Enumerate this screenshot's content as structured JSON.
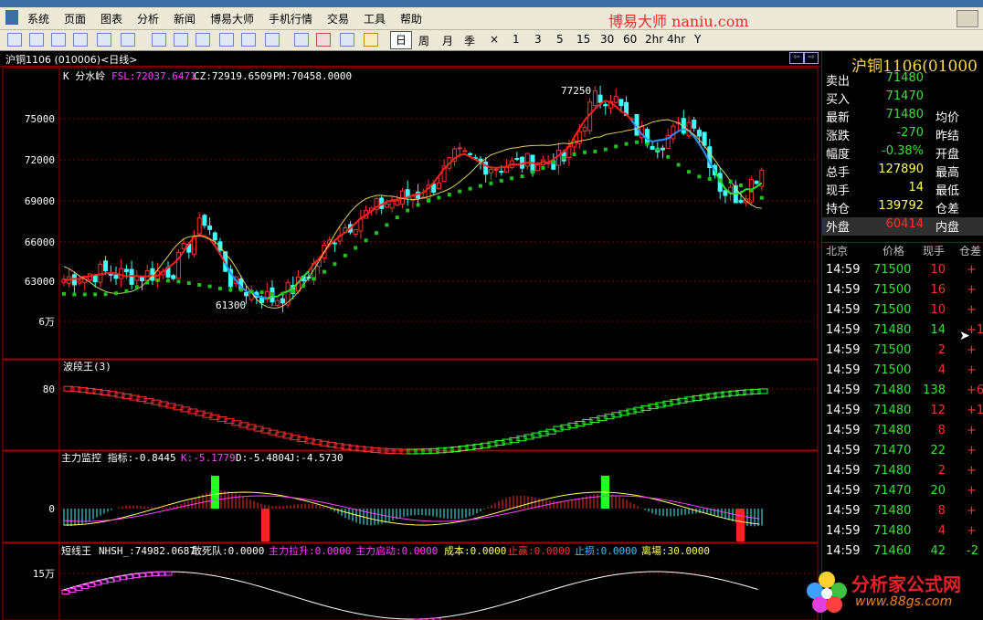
{
  "menu": [
    "系统",
    "页面",
    "图表",
    "分析",
    "新闻",
    "博易大师",
    "手机行情",
    "交易",
    "工具",
    "帮助"
  ],
  "brand": "博易大师 naniu.com",
  "periods": [
    "日",
    "周",
    "月",
    "季",
    "×",
    "1",
    "3",
    "5",
    "15",
    "30",
    "60",
    "2hr",
    "4hr",
    "Y"
  ],
  "chart_title": "沪铜1106 (010006)<日线>",
  "kline": {
    "header": {
      "name": "K 分水岭",
      "fsl": "FSL:72037.6471",
      "cz": "CZ:72919.6509",
      "pm": "PM:70458.0000"
    },
    "y_labels": [
      "75000",
      "72000",
      "69000",
      "66000",
      "63000",
      "6万"
    ],
    "annot_high": "77250",
    "annot_low": "61300"
  },
  "wave": {
    "title": "波段王(3)",
    "y_label": "80"
  },
  "main_force": {
    "title": "主力监控 指标:-0.8445",
    "k": "K:-5.1779",
    "d": "D:-5.4804",
    "j": "J:-4.5730",
    "y_label": "0"
  },
  "short": {
    "title": "短线王",
    "nhsh": "NHSH_:74982.0687",
    "fields": [
      {
        "label": "敢死队:0.0000",
        "color": "#ffffff"
      },
      {
        "label": "主力拉升:0.0000",
        "color": "#ff40ff"
      },
      {
        "label": "主力启动:0.0000",
        "color": "#ff40ff"
      },
      {
        "label": "成本:0.0000",
        "color": "#ffff60"
      },
      {
        "label": "止赢:0.0000",
        "color": "#ff3030"
      },
      {
        "label": "止损:0.0000",
        "color": "#40c0ff"
      },
      {
        "label": "离場:30.0000",
        "color": "#ffff60"
      }
    ],
    "y_label": "15万"
  },
  "quote": {
    "symbol": "沪铜1106(01000",
    "rows": [
      {
        "label": "卖出",
        "value": "71480",
        "vcolor": "#3ce03c",
        "right": ""
      },
      {
        "label": "买入",
        "value": "71470",
        "vcolor": "#3ce03c",
        "right": ""
      },
      {
        "label": "最新",
        "value": "71480",
        "vcolor": "#3ce03c",
        "right": "均价"
      },
      {
        "label": "涨跌",
        "value": "-270",
        "vcolor": "#3ce03c",
        "right": "昨结"
      },
      {
        "label": "幅度",
        "value": "-0.38%",
        "vcolor": "#3ce03c",
        "right": "开盘"
      },
      {
        "label": "总手",
        "value": "127890",
        "vcolor": "#ffff60",
        "right": "最高"
      },
      {
        "label": "现手",
        "value": "14",
        "vcolor": "#ffff60",
        "right": "最低"
      },
      {
        "label": "持仓",
        "value": "139792",
        "vcolor": "#ffff60",
        "right": "仓差"
      },
      {
        "label": "外盘",
        "value": "60414",
        "vcolor": "#ff3030",
        "right": "内盘"
      }
    ]
  },
  "trades_header": [
    "北京",
    "价格",
    "现手",
    "仓差"
  ],
  "trades": [
    {
      "time": "14:59",
      "price": "71500",
      "vol": "10",
      "vcolor": "#ff3030",
      "chg": "+"
    },
    {
      "time": "14:59",
      "price": "71500",
      "vol": "16",
      "vcolor": "#ff3030",
      "chg": "+"
    },
    {
      "time": "14:59",
      "price": "71500",
      "vol": "10",
      "vcolor": "#ff3030",
      "chg": "+"
    },
    {
      "time": "14:59",
      "price": "71480",
      "vol": "14",
      "vcolor": "#3ce03c",
      "chg": "+1"
    },
    {
      "time": "14:59",
      "price": "71500",
      "vol": "2",
      "vcolor": "#ff3030",
      "chg": "+"
    },
    {
      "time": "14:59",
      "price": "71500",
      "vol": "4",
      "vcolor": "#ff3030",
      "chg": "+"
    },
    {
      "time": "14:59",
      "price": "71480",
      "vol": "138",
      "vcolor": "#3ce03c",
      "chg": "+6"
    },
    {
      "time": "14:59",
      "price": "71480",
      "vol": "12",
      "vcolor": "#ff3030",
      "chg": "+1"
    },
    {
      "time": "14:59",
      "price": "71480",
      "vol": "8",
      "vcolor": "#ff3030",
      "chg": "+"
    },
    {
      "time": "14:59",
      "price": "71470",
      "vol": "22",
      "vcolor": "#3ce03c",
      "chg": "+"
    },
    {
      "time": "14:59",
      "price": "71480",
      "vol": "2",
      "vcolor": "#ff3030",
      "chg": "+"
    },
    {
      "time": "14:59",
      "price": "71470",
      "vol": "20",
      "vcolor": "#3ce03c",
      "chg": "+"
    },
    {
      "time": "14:59",
      "price": "71480",
      "vol": "8",
      "vcolor": "#ff3030",
      "chg": "+"
    },
    {
      "time": "14:59",
      "price": "71480",
      "vol": "4",
      "vcolor": "#ff3030",
      "chg": "+"
    },
    {
      "time": "14:59",
      "price": "71460",
      "vol": "42",
      "vcolor": "#3ce03c",
      "chg": "-2"
    }
  ],
  "watermark": {
    "name": "分析家公式网",
    "url": "www.88gs.com"
  },
  "colors": {
    "up": "#ff3030",
    "down": "#40ffff",
    "grid": "#800000",
    "panel_border": "#a00000"
  }
}
